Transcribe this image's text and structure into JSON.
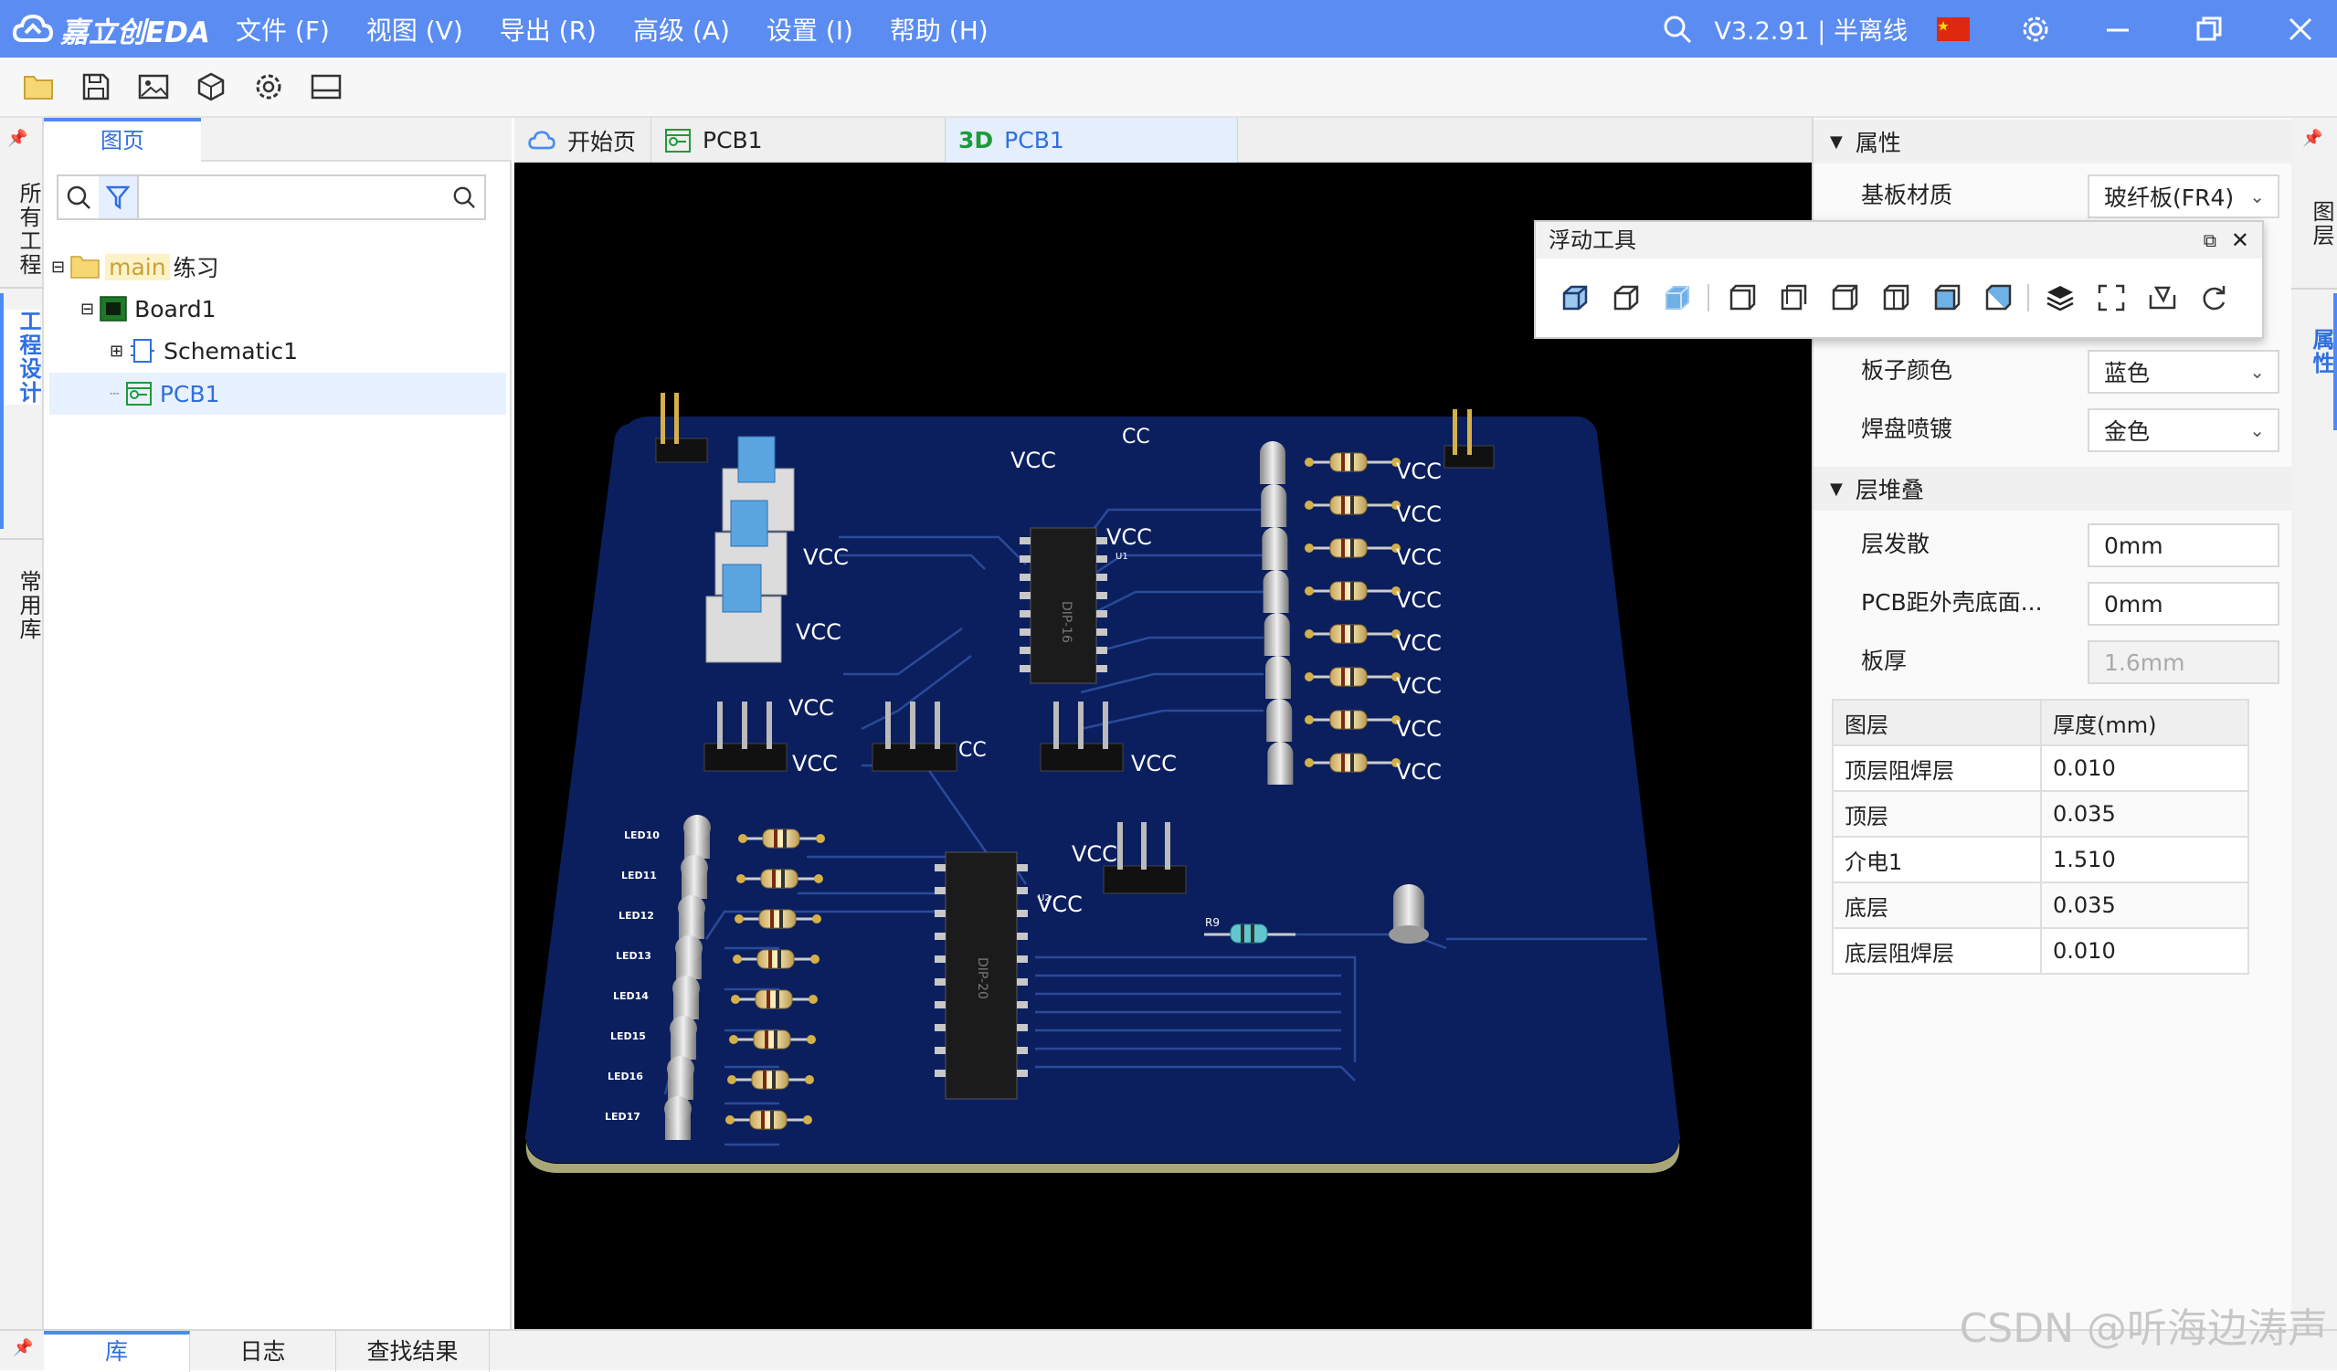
{
  "app": {
    "logo_text": "嘉立创EDA",
    "version": "V3.2.91 | 半离线",
    "menu": [
      "文件 (F)",
      "视图 (V)",
      "导出 (R)",
      "高级 (A)",
      "设置 (I)",
      "帮助 (H)"
    ]
  },
  "left_strip": {
    "tabs": [
      "所有工程",
      "工程设计",
      "常用库"
    ],
    "active": "工程设计"
  },
  "left_panel": {
    "tab": "图页",
    "search_placeholder": "",
    "tree": [
      {
        "label_tag": "main",
        "label": "练习"
      },
      {
        "label": "Board1"
      },
      {
        "label": "Schematic1"
      },
      {
        "label": "PCB1"
      }
    ]
  },
  "doc_tabs": [
    {
      "label": "开始页"
    },
    {
      "label": "PCB1"
    },
    {
      "prefix": "3D",
      "label": "PCB1"
    }
  ],
  "properties": {
    "section_title": "属性",
    "fields": [
      {
        "label": "基板材质",
        "value": "玻纤板(FR4)"
      },
      {
        "label": "板子颜色",
        "value": "蓝色"
      },
      {
        "label": "焊盘喷镀",
        "value": "金色"
      }
    ],
    "stack_title": "层堆叠",
    "stack_fields": [
      {
        "label": "层发散",
        "value": "0mm"
      },
      {
        "label": "PCB距外壳底面...",
        "value": "0mm"
      },
      {
        "label": "板厚",
        "value": "1.6mm"
      }
    ],
    "table": {
      "headers": [
        "图层",
        "厚度(mm)"
      ],
      "rows": [
        [
          "顶层阻焊层",
          "0.010"
        ],
        [
          "顶层",
          "0.035"
        ],
        [
          "介电1",
          "1.510"
        ],
        [
          "底层",
          "0.035"
        ],
        [
          "底层阻焊层",
          "0.010"
        ]
      ]
    }
  },
  "right_strip": {
    "tabs": [
      "图层",
      "属性"
    ]
  },
  "float_tools": {
    "title": "浮动工具"
  },
  "bottom_tabs": [
    "库",
    "日志",
    "查找结果"
  ],
  "pcb_labels": {
    "vcc": "VCC",
    "cc": "CC",
    "ic1": "DIP-16",
    "ic2": "DIP-20",
    "u1": "U1",
    "u2": "U2",
    "r9": "R9",
    "leds": [
      "LED10",
      "LED11",
      "LED12",
      "LED13",
      "LED14",
      "LED15",
      "LED16",
      "LED17"
    ]
  },
  "watermark": "CSDN @听海边涛声",
  "colors": {
    "titlebar": "#5b8cf1",
    "board": "#0b1f5e",
    "accent": "#2f6fe0"
  }
}
